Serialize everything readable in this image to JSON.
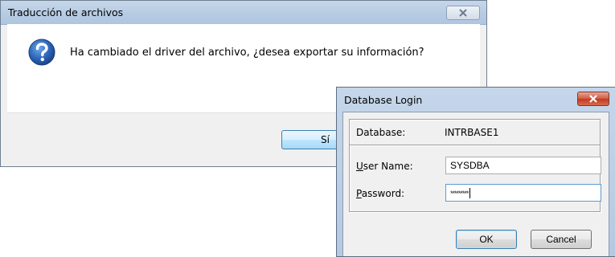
{
  "translate_dialog": {
    "title": "Traducción de archivos",
    "message": "Ha cambiado el driver del archivo, ¿desea exportar su información?",
    "yes_label": "Sí",
    "icon": "question-icon"
  },
  "login_dialog": {
    "title": "Database Login",
    "database_label": "Database:",
    "database_value": "INTRBASE1",
    "user_label_underlined": "U",
    "user_label_rest": "ser Name:",
    "user_value": "SYSDBA",
    "password_label_underlined": "P",
    "password_label_rest": "assword:",
    "password_value": "*********",
    "ok_label": "OK",
    "cancel_label": "Cancel"
  },
  "colors": {
    "titlebar": "#b9cde5",
    "close_active": "#c8472b",
    "default_button_border": "#3c7fb1"
  }
}
